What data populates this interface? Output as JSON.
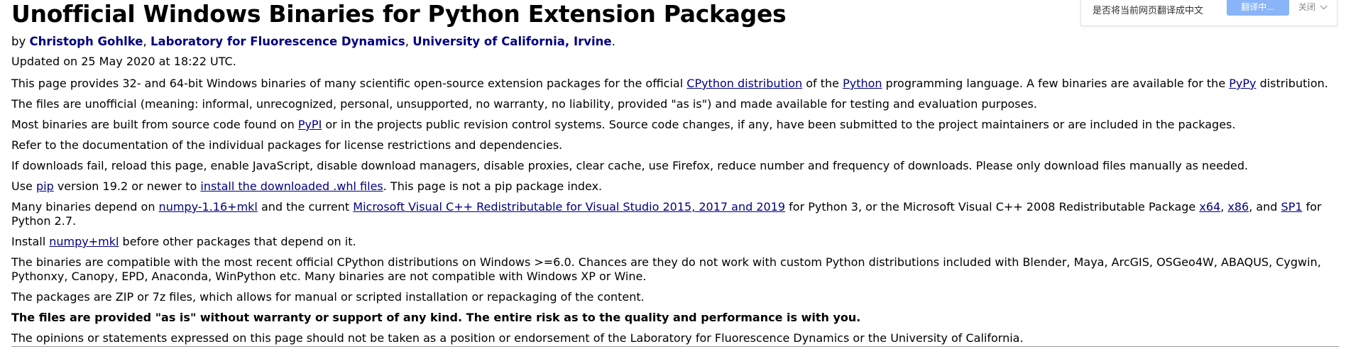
{
  "header": {
    "title": "Unofficial Windows Binaries for Python Extension Packages",
    "by_prefix": "by ",
    "author": "Christoph Gohlke",
    "sep1": ", ",
    "lab": "Laboratory for Fluorescence Dynamics",
    "sep2": ", ",
    "university": "University of California, Irvine",
    "end": ".",
    "updated": "Updated on 25 May 2020 at 18:22 UTC."
  },
  "translate_bar": {
    "prompt": "是否将当前网页翻译成中文",
    "translate_label": "翻译中...",
    "close_label": "关闭"
  },
  "paragraphs": {
    "p1": {
      "t1": "This page provides 32- and 64-bit Windows binaries of many scientific open-source extension packages for the official ",
      "l1": "CPython distribution",
      "t2": " of the ",
      "l2": "Python",
      "t3": " programming language. A few binaries are available for the ",
      "l3": "PyPy",
      "t4": " distribution."
    },
    "p2": "The files are unofficial (meaning: informal, unrecognized, personal, unsupported, no warranty, no liability, provided \"as is\") and made available for testing and evaluation purposes.",
    "p3": {
      "t1": "Most binaries are built from source code found on ",
      "l1": "PyPI",
      "t2": " or in the projects public revision control systems. Source code changes, if any, have been submitted to the project maintainers or are included in the packages."
    },
    "p4": "Refer to the documentation of the individual packages for license restrictions and dependencies.",
    "p5": "If downloads fail, reload this page, enable JavaScript, disable download managers, disable proxies, clear cache, use Firefox, reduce number and frequency of downloads. Please only download files manually as needed.",
    "p6": {
      "t1": "Use ",
      "l1": "pip",
      "t2": " version 19.2 or newer to ",
      "l2": "install the downloaded .whl files",
      "t3": ". This page is not a pip package index."
    },
    "p7": {
      "t1": "Many binaries depend on ",
      "l1": "numpy-1.16+mkl",
      "t2": " and the current ",
      "l2": "Microsoft Visual C++ Redistributable for Visual Studio 2015, 2017 and 2019",
      "t3": " for Python 3, or the Microsoft Visual C++ 2008 Redistributable Package ",
      "l3": "x64",
      "t4": ", ",
      "l4": "x86",
      "t5": ", and ",
      "l5": "SP1",
      "t6": " for Python 2.7."
    },
    "p8": {
      "t1": "Install ",
      "l1": "numpy+mkl",
      "t2": " before other packages that depend on it."
    },
    "p9": "The binaries are compatible with the most recent official CPython distributions on Windows >=6.0. Chances are they do not work with custom Python distributions included with Blender, Maya, ArcGIS, OSGeo4W, ABAQUS, Cygwin, Pythonxy, Canopy, EPD, Anaconda, WinPython etc. Many binaries are not compatible with Windows XP or Wine.",
    "p10": "The packages are ZIP or 7z files, which allows for manual or scripted installation or repackaging of the content.",
    "p11": "The files are provided \"as is\" without warranty or support of any kind. The entire risk as to the quality and performance is with you.",
    "p12": "The opinions or statements expressed on this page should not be taken as a position or endorsement of the Laboratory for Fluorescence Dynamics or the University of California."
  },
  "colors": {
    "link": "#000080",
    "translate_button": "#8ab4f8"
  }
}
